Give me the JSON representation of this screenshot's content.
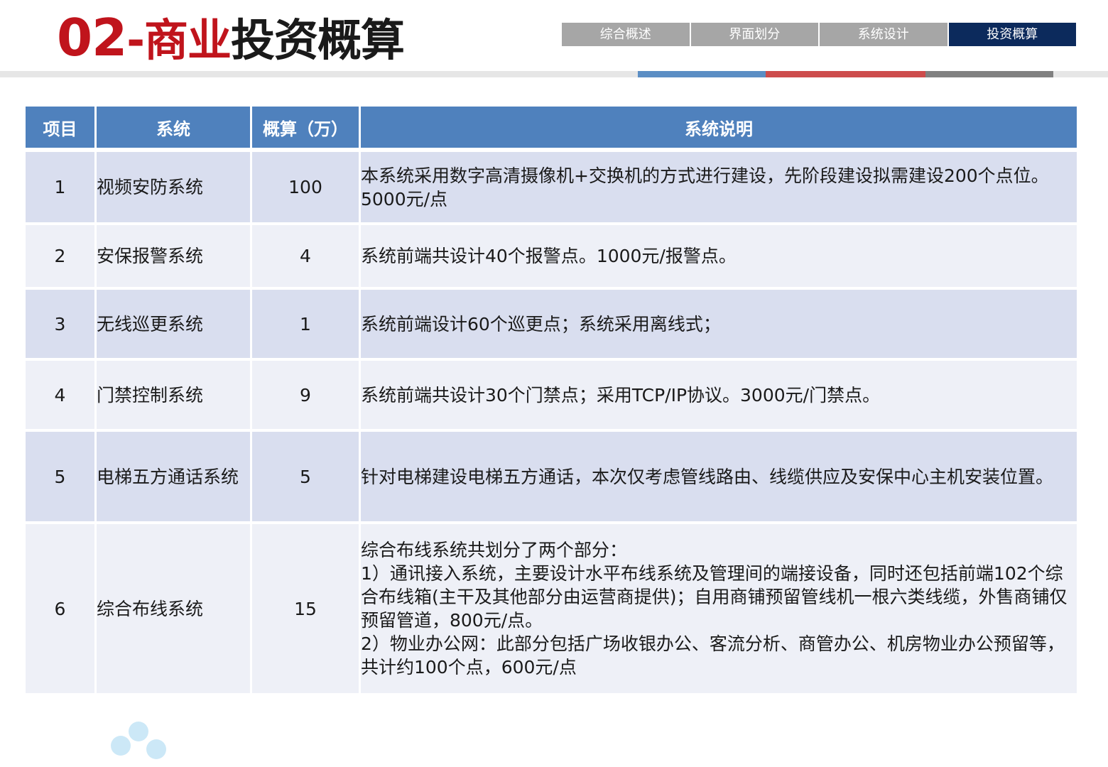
{
  "title": {
    "number": "02",
    "separator": "-",
    "red_part": "商业",
    "dark_part": "投资概算"
  },
  "nav": {
    "tabs": [
      {
        "label": "综合概述",
        "active": false
      },
      {
        "label": "界面划分",
        "active": false
      },
      {
        "label": "系统设计",
        "active": false
      },
      {
        "label": "投资概算",
        "active": true
      }
    ]
  },
  "table": {
    "headers": [
      "项目",
      "系统",
      "概算（万）",
      "系统说明"
    ],
    "rows": [
      {
        "no": "1",
        "system": "视频安防系统",
        "amount": "100",
        "description": "本系统采用数字高清摄像机+交换机的方式进行建设，先阶段建设拟需建设200个点位。5000元/点"
      },
      {
        "no": "2",
        "system": "安保报警系统",
        "amount": "4",
        "description": "系统前端共设计40个报警点。1000元/报警点。"
      },
      {
        "no": "3",
        "system": "无线巡更系统",
        "amount": "1",
        "description": "系统前端设计60个巡更点；系统采用离线式；"
      },
      {
        "no": "4",
        "system": "门禁控制系统",
        "amount": "9",
        "description": "系统前端共设计30个门禁点；采用TCP/IP协议。3000元/门禁点。"
      },
      {
        "no": "5",
        "system": "电梯五方通话系统",
        "amount": "5",
        "description": "针对电梯建设电梯五方通话，本次仅考虑管线路由、线缆供应及安保中心主机安装位置。"
      },
      {
        "no": "6",
        "system": "综合布线系统",
        "amount": "15",
        "description": "综合布线系统共划分了两个部分：\n1）通讯接入系统，主要设计水平布线系统及管理间的端接设备，同时还包括前端102个综合布线箱(主干及其他部分由运营商提供)；自用商铺预留管线机一根六类线缆，外售商铺仅预留管道，800元/点。\n2）物业办公网：此部分包括广场收银办公、客流分析、商管办公、机房物业办公预留等，共计约100个点，600元/点"
      }
    ]
  },
  "colors": {
    "title_red": "#c0141c",
    "header_blue": "#4f81bd",
    "nav_active": "#0c2a5c",
    "nav_inactive": "#a6a6a6",
    "row_odd": "#d9deef",
    "row_even": "#eef0f7"
  }
}
